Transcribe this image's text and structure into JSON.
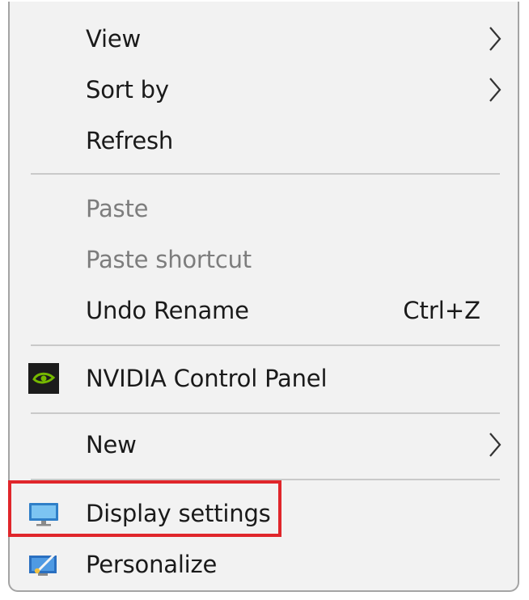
{
  "menu": {
    "items": [
      {
        "label": "View",
        "shortcut": "",
        "submenu": true,
        "disabled": false,
        "icon": ""
      },
      {
        "label": "Sort by",
        "shortcut": "",
        "submenu": true,
        "disabled": false,
        "icon": ""
      },
      {
        "label": "Refresh",
        "shortcut": "",
        "submenu": false,
        "disabled": false,
        "icon": ""
      },
      {
        "label": "Paste",
        "shortcut": "",
        "submenu": false,
        "disabled": true,
        "icon": ""
      },
      {
        "label": "Paste shortcut",
        "shortcut": "",
        "submenu": false,
        "disabled": true,
        "icon": ""
      },
      {
        "label": "Undo Rename",
        "shortcut": "Ctrl+Z",
        "submenu": false,
        "disabled": false,
        "icon": ""
      },
      {
        "label": "NVIDIA Control Panel",
        "shortcut": "",
        "submenu": false,
        "disabled": false,
        "icon": "nvidia-icon"
      },
      {
        "label": "New",
        "shortcut": "",
        "submenu": true,
        "disabled": false,
        "icon": ""
      },
      {
        "label": "Display settings",
        "shortcut": "",
        "submenu": false,
        "disabled": false,
        "icon": "monitor-icon",
        "highlighted": true
      },
      {
        "label": "Personalize",
        "shortcut": "",
        "submenu": false,
        "disabled": false,
        "icon": "personalize-icon"
      }
    ]
  },
  "colors": {
    "menu_background": "#f2f2f2",
    "text": "#1a1a1a",
    "disabled_text": "#7d7d7d",
    "separator": "#c9c9c9",
    "highlight_border": "#e0262b",
    "nvidia_green": "#76b900"
  }
}
